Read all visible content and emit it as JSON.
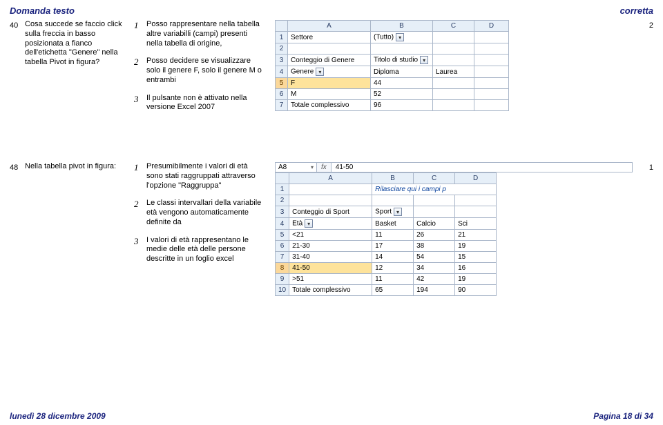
{
  "header": {
    "left": "Domanda  testo",
    "right": "corretta"
  },
  "q40": {
    "num": "40",
    "text": "Cosa succede se faccio click sulla freccia in basso posizionata a fianco dell'etichetta \"Genere\" nella tabella Pivot in figura?",
    "opts": [
      "Posso rappresentare nella tabella altre variabilli (campi) presenti nella tabella di origine,",
      "Posso decidere se visualizzare solo il genere F, solo il genere M o entrambi",
      "Il pulsante non è attivato nella versione Excel 2007"
    ],
    "optnums": [
      "1",
      "2",
      "3"
    ],
    "correct": "2",
    "pivot": {
      "cols": [
        "A",
        "B",
        "C",
        "D"
      ],
      "r1": {
        "label": "Settore",
        "val": "(Tutto)"
      },
      "r3": {
        "label": "Conteggio di Genere",
        "colfield": "Titolo di studio"
      },
      "r4": {
        "rowfield": "Genere",
        "c1": "Diploma",
        "c2": "Laurea"
      },
      "r5": [
        "F",
        "44"
      ],
      "r6": [
        "M",
        "52"
      ],
      "r7": [
        "Totale complessivo",
        "96"
      ]
    }
  },
  "q48": {
    "num": "48",
    "text": "Nella tabella pivot in figura:",
    "opts": [
      "Presumibilmente i valori di età sono stati raggruppati attraverso l'opzione \"Raggruppa\"",
      "Le classi intervallari della variabile età vengono automaticamente definite da",
      "I valori di età rappresentano le medie delle età delle persone descritte in un foglio excel"
    ],
    "optnums": [
      "1",
      "2",
      "3"
    ],
    "correct": "1",
    "fx": {
      "ref": "A8",
      "val": "41-50"
    },
    "pivot": {
      "cols": [
        "A",
        "B",
        "C",
        "D"
      ],
      "r1": {
        "hint": "Rilasciare qui i campi p"
      },
      "r3": {
        "label": "Conteggio di Sport",
        "colfield": "Sport"
      },
      "r4": {
        "rowfield": "Età",
        "c1": "Basket",
        "c2": "Calcio",
        "c3": "Sci"
      },
      "rows": [
        [
          "<21",
          "11",
          "26",
          "21"
        ],
        [
          "21-30",
          "17",
          "38",
          "19"
        ],
        [
          "31-40",
          "14",
          "54",
          "15"
        ],
        [
          "41-50",
          "12",
          "34",
          "16"
        ],
        [
          ">51",
          "11",
          "42",
          "19"
        ],
        [
          "Totale complessivo",
          "65",
          "194",
          "90"
        ]
      ],
      "rownums": [
        "5",
        "6",
        "7",
        "8",
        "9",
        "10"
      ]
    }
  },
  "footer": {
    "left": "lunedì 28 dicembre 2009",
    "right": "Pagina 18 di 34"
  }
}
